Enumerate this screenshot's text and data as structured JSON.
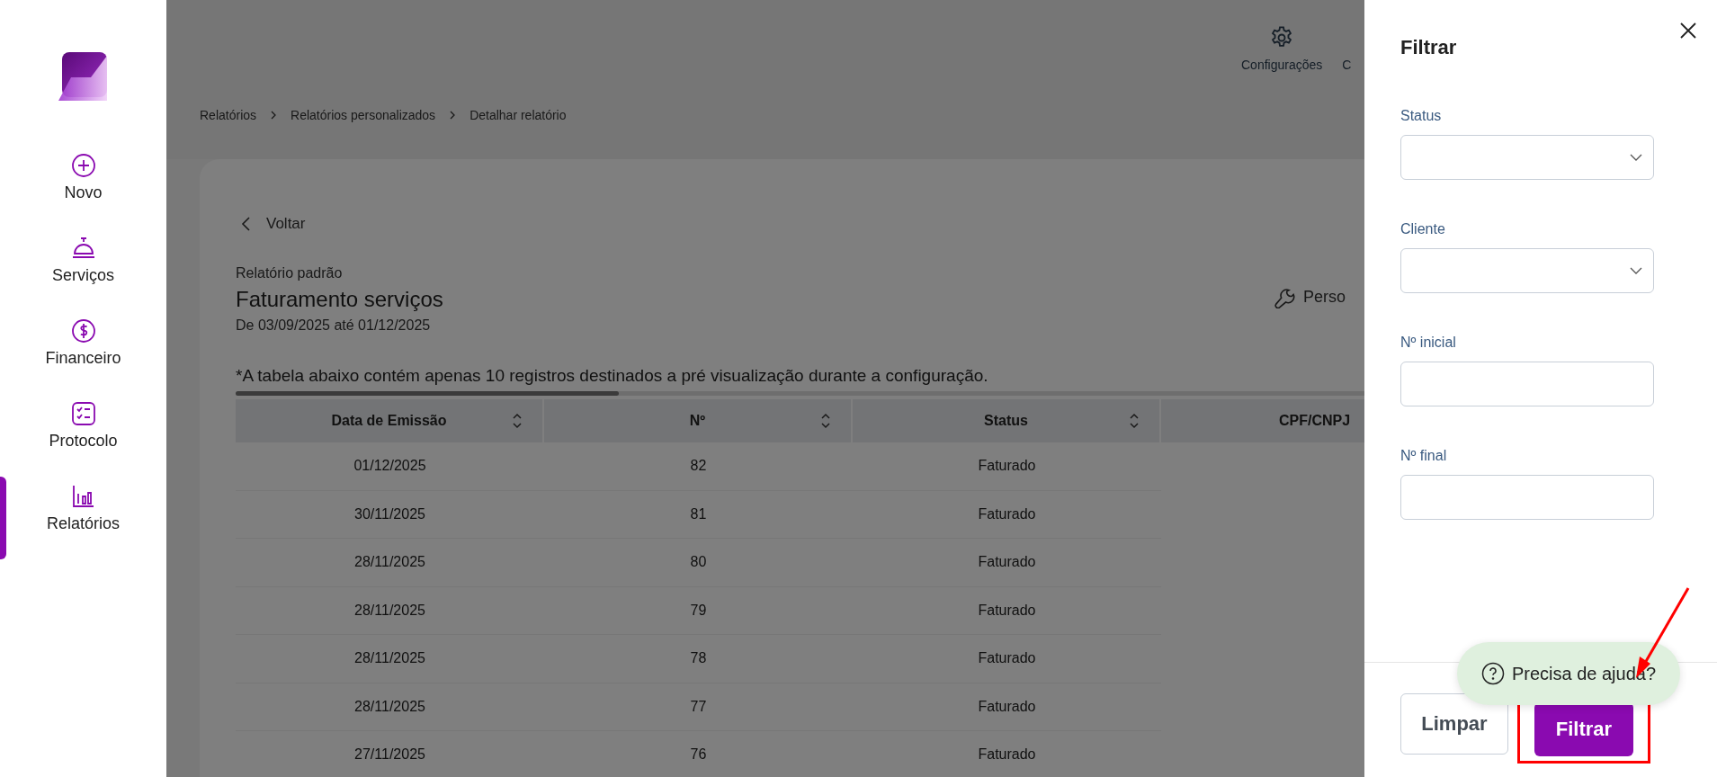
{
  "sidebar": {
    "items": [
      {
        "label": "Novo",
        "selected": false
      },
      {
        "label": "Serviços",
        "selected": false
      },
      {
        "label": "Financeiro",
        "selected": false
      },
      {
        "label": "Protocolo",
        "selected": false
      },
      {
        "label": "Relatórios",
        "selected": true
      }
    ]
  },
  "header": {
    "items": [
      {
        "label": "Configurações"
      },
      {
        "label": "C"
      }
    ]
  },
  "breadcrumb": [
    "Relatórios",
    "Relatórios personalizados",
    "Detalhar relatório"
  ],
  "report": {
    "back": "Voltar",
    "kind_label": "Relatório padrão",
    "title": "Faturamento serviços",
    "period": "De 03/09/2025 até 01/12/2025",
    "customize": "Perso",
    "note": "*A tabela abaixo contém apenas 10 registros destinados a pré visualização durante a configuração."
  },
  "table": {
    "columns": [
      {
        "label": "Data de Emissão",
        "sortable": true
      },
      {
        "label": "Nº",
        "sortable": true
      },
      {
        "label": "Status",
        "sortable": true
      },
      {
        "label": "CPF/CNPJ",
        "sortable": false
      }
    ],
    "rows": [
      [
        "01/12/2025",
        "82",
        "Faturado"
      ],
      [
        "30/11/2025",
        "81",
        "Faturado"
      ],
      [
        "28/11/2025",
        "80",
        "Faturado"
      ],
      [
        "28/11/2025",
        "79",
        "Faturado"
      ],
      [
        "28/11/2025",
        "78",
        "Faturado"
      ],
      [
        "28/11/2025",
        "77",
        "Faturado"
      ],
      [
        "27/11/2025",
        "76",
        "Faturado"
      ]
    ]
  },
  "drawer": {
    "title": "Filtrar",
    "fields": [
      {
        "label": "Status",
        "kind": "select"
      },
      {
        "label": "Cliente",
        "kind": "select"
      },
      {
        "label": "Nº inicial",
        "kind": "input"
      },
      {
        "label": "Nº final",
        "kind": "input"
      }
    ],
    "buttons": [
      {
        "label": "Limpar",
        "kind": "secondary"
      },
      {
        "label": "Filtrar",
        "kind": "primary"
      }
    ]
  },
  "help": {
    "label": "Precisa de ajuda?"
  }
}
